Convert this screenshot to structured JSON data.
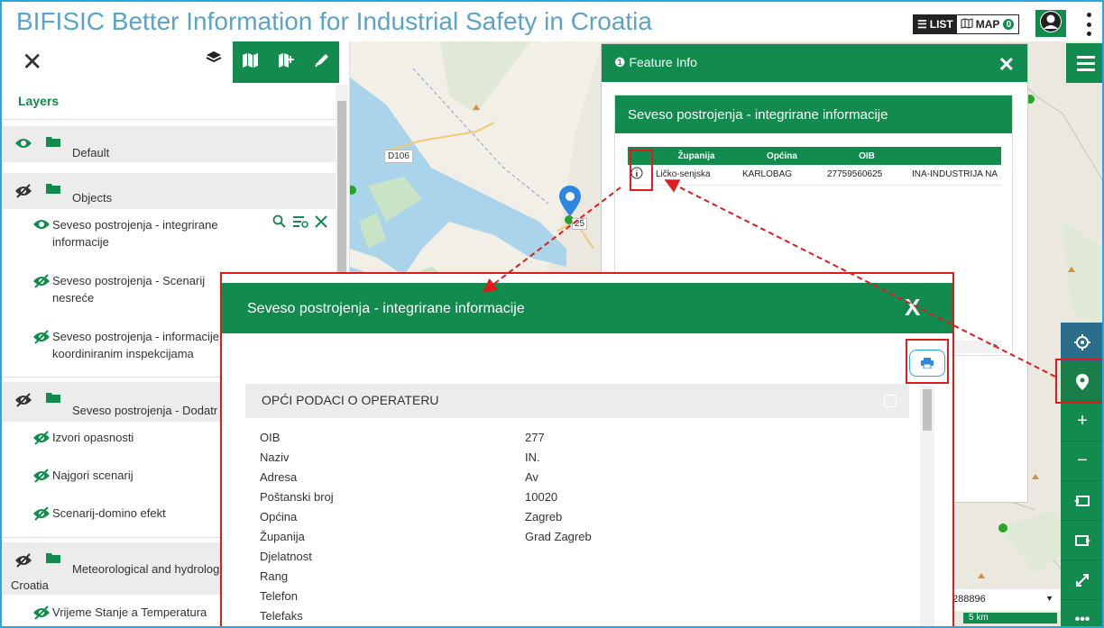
{
  "header": {
    "title": "BIFISIC Better Information for Industrial Safety in Croatia",
    "list_label": "LIST",
    "map_label": "MAP",
    "map_count": "0"
  },
  "left_panel": {
    "layers_heading": "Layers",
    "groups": [
      {
        "label": "Default"
      },
      {
        "label": "Objects"
      },
      {
        "label": "Seveso postrojenja - Dodatr"
      },
      {
        "label": "Meteorological and hydrolog",
        "label2": "Croatia"
      }
    ],
    "items": [
      {
        "label": "Seveso postrojenja - integrirane informacije"
      },
      {
        "label": "Seveso postrojenja - Scenarij nesreće"
      },
      {
        "label": "Seveso postrojenja - informacije koordiniranim inspekcijama"
      },
      {
        "label": "Izvori opasnosti"
      },
      {
        "label": "Najgori scenarij"
      },
      {
        "label": "Scenarij-domino efekt"
      },
      {
        "label": "Vrijeme Stanje a Temperatura"
      }
    ]
  },
  "map": {
    "road_label": "D106",
    "marker_label": "25"
  },
  "feature_info": {
    "title": "Feature Info",
    "layer_title": "Seveso postrojenja - integrirane informacije",
    "columns": [
      "Županija",
      "Općina",
      "OIB",
      ""
    ],
    "row": {
      "zupanija": "Ličko-senjska",
      "opcina": "KARLOBAG",
      "oib": "27759560625",
      "naziv": "INA-INDUSTRIJA NA"
    }
  },
  "popup": {
    "title": "Seveso postrojenja - integrirane informacije",
    "close_label": "X",
    "section_title": "OPĆI PODACI O OPERATERU",
    "fields": [
      {
        "k": "OIB",
        "v": "277"
      },
      {
        "k": "Naziv",
        "v": "IN."
      },
      {
        "k": "Adresa",
        "v": "Av"
      },
      {
        "k": "Poštanski broj",
        "v": "10020"
      },
      {
        "k": "Općina",
        "v": "Zagreb"
      },
      {
        "k": "Županija",
        "v": "Grad Zagreb"
      },
      {
        "k": "Djelatnost",
        "v": ""
      },
      {
        "k": "Rang",
        "v": ""
      },
      {
        "k": "Telefon",
        "v": ""
      },
      {
        "k": "Telefaks",
        "v": ""
      }
    ]
  },
  "scale": {
    "select_value": "288896",
    "bar_label": "5 km"
  },
  "colors": {
    "brand_green": "#138a4e",
    "title_blue": "#5aa3c9",
    "highlight_red": "#e01b1b"
  }
}
